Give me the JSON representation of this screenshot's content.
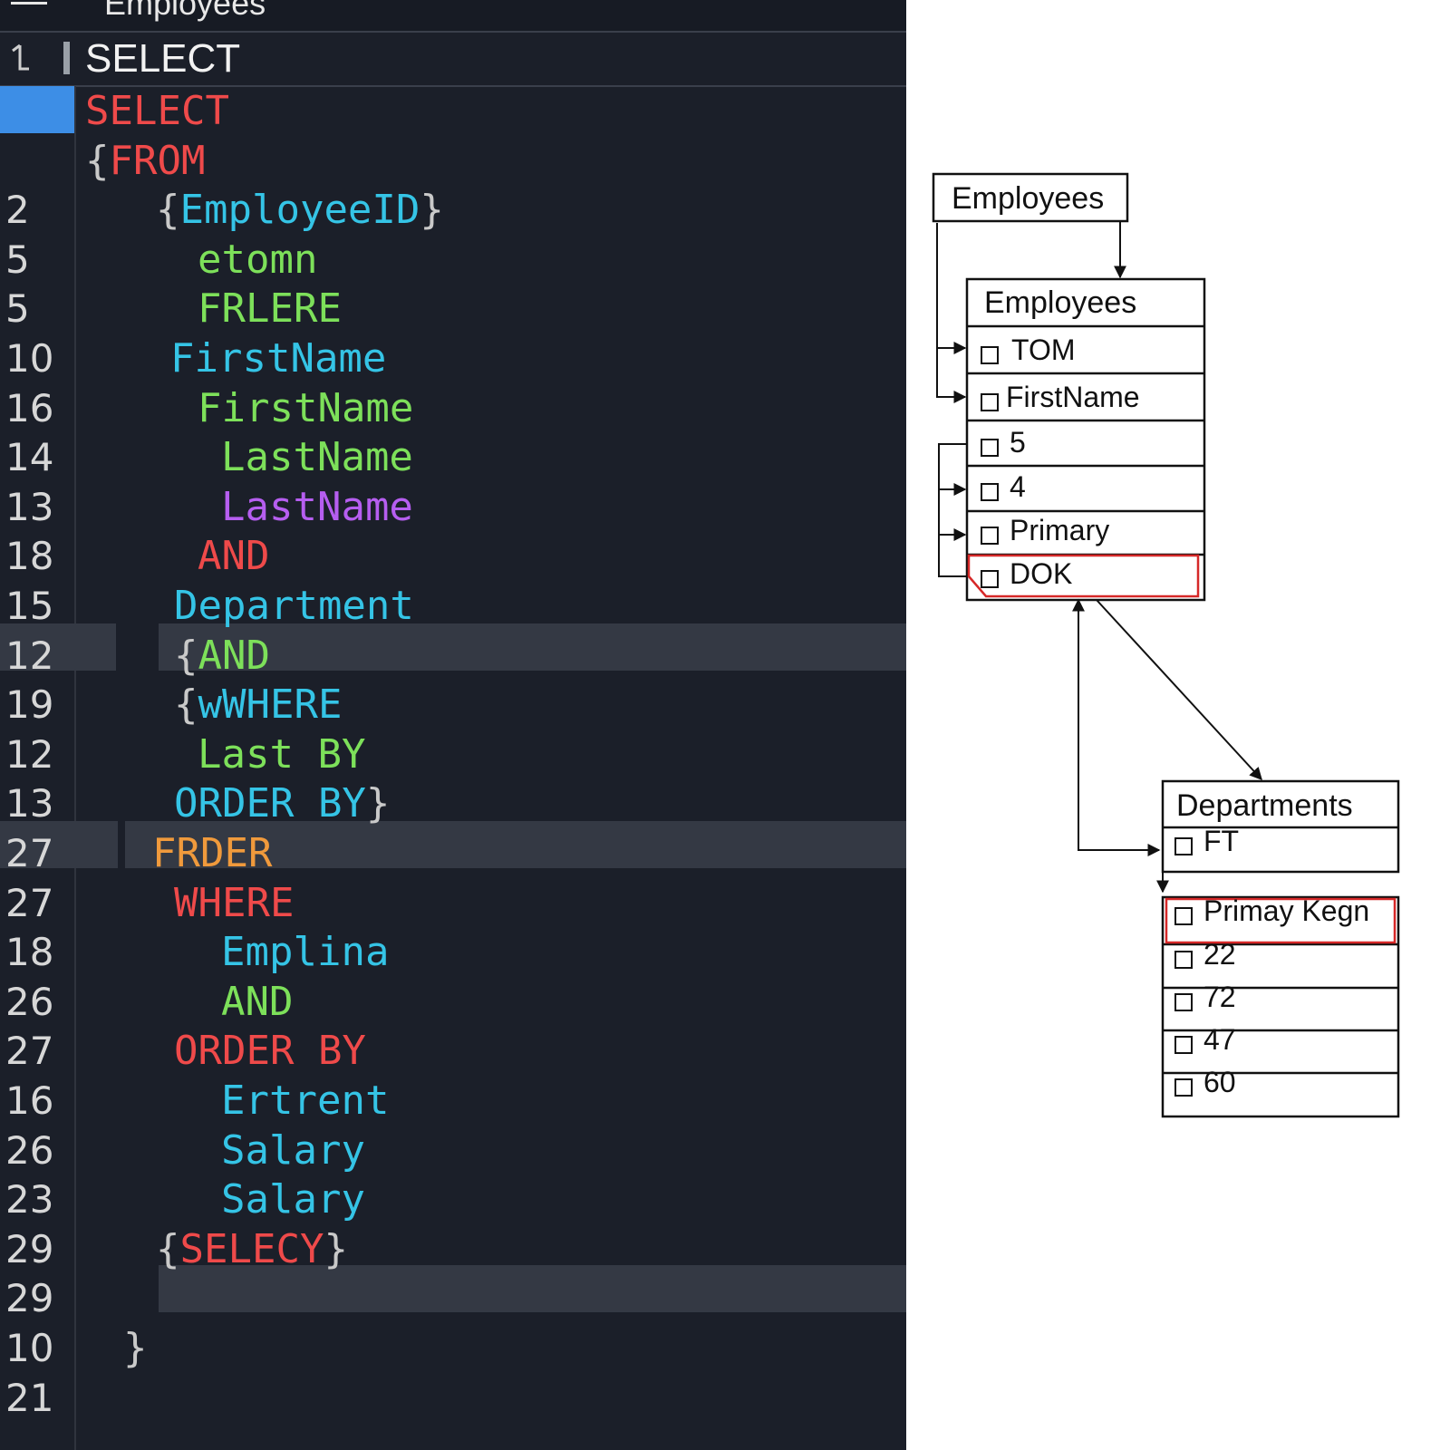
{
  "window": {
    "title": "Employees"
  },
  "editor": {
    "header_text": "SELECT",
    "lines": [
      {
        "num": "",
        "tokens": [
          {
            "t": "SELECT",
            "c": "red"
          }
        ]
      },
      {
        "num": "",
        "tokens": [
          {
            "t": "{",
            "c": "br"
          },
          {
            "t": "FROM",
            "c": "red"
          }
        ]
      },
      {
        "num": "2",
        "tokens": [
          {
            "t": "{",
            "c": "br"
          },
          {
            "t": "EmployeeID",
            "c": "cyan"
          },
          {
            "t": "}",
            "c": "br"
          }
        ]
      },
      {
        "num": "5",
        "tokens": [
          {
            "t": "etomn",
            "c": "green"
          }
        ]
      },
      {
        "num": "5",
        "tokens": [
          {
            "t": "FRLERE",
            "c": "green"
          }
        ]
      },
      {
        "num": "10",
        "tokens": [
          {
            "t": "FirstName",
            "c": "cyan"
          }
        ]
      },
      {
        "num": "16",
        "tokens": [
          {
            "t": "FirstName",
            "c": "green"
          }
        ]
      },
      {
        "num": "14",
        "tokens": [
          {
            "t": "LastName",
            "c": "green"
          }
        ]
      },
      {
        "num": "13",
        "tokens": [
          {
            "t": "LastName",
            "c": "purple"
          }
        ]
      },
      {
        "num": "18",
        "tokens": [
          {
            "t": "AND",
            "c": "red"
          }
        ]
      },
      {
        "num": "15",
        "tokens": [
          {
            "t": "Department",
            "c": "cyan"
          }
        ]
      },
      {
        "num": "12",
        "tokens": [
          {
            "t": "{",
            "c": "br"
          },
          {
            "t": "AND",
            "c": "green"
          }
        ]
      },
      {
        "num": "19",
        "tokens": [
          {
            "t": "{",
            "c": "br"
          },
          {
            "t": "wWHERE",
            "c": "cyan"
          }
        ]
      },
      {
        "num": "12",
        "tokens": [
          {
            "t": "Last BY",
            "c": "green"
          }
        ]
      },
      {
        "num": "13",
        "tokens": [
          {
            "t": "ORDER BY",
            "c": "cyan"
          },
          {
            "t": "}",
            "c": "br"
          }
        ]
      },
      {
        "num": "27",
        "tokens": [
          {
            "t": "FRDER",
            "c": "orange"
          }
        ]
      },
      {
        "num": "27",
        "tokens": [
          {
            "t": "WHERE",
            "c": "red"
          }
        ]
      },
      {
        "num": "18",
        "tokens": [
          {
            "t": "Emplina",
            "c": "cyan"
          }
        ]
      },
      {
        "num": "26",
        "tokens": [
          {
            "t": "AND",
            "c": "green"
          }
        ]
      },
      {
        "num": "27",
        "tokens": [
          {
            "t": "ORDER BY",
            "c": "red"
          }
        ]
      },
      {
        "num": "16",
        "tokens": [
          {
            "t": "Ertrent",
            "c": "cyan"
          }
        ]
      },
      {
        "num": "26",
        "tokens": [
          {
            "t": "Salary",
            "c": "cyan"
          }
        ]
      },
      {
        "num": "23",
        "tokens": [
          {
            "t": "Salary",
            "c": "cyan"
          }
        ]
      },
      {
        "num": "29",
        "tokens": [
          {
            "t": "{",
            "c": "br"
          },
          {
            "t": "SELECY",
            "c": "red"
          },
          {
            "t": "}",
            "c": "br"
          }
        ]
      },
      {
        "num": "29",
        "tokens": []
      },
      {
        "num": "10",
        "tokens": [
          {
            "t": "}",
            "c": "br"
          }
        ]
      },
      {
        "num": "21",
        "tokens": []
      }
    ]
  },
  "diagram": {
    "top_box": {
      "title": "Employees"
    },
    "employees_table": {
      "title": "Employees",
      "rows": [
        "TOM",
        "FirstName",
        "5",
        "4",
        "Primary",
        "DOK"
      ],
      "highlighted_row": "DOK"
    },
    "departments_table": {
      "title": "Departments",
      "rows": [
        "FT"
      ]
    },
    "values_table": {
      "rows": [
        "Primay Kegn",
        "22",
        "72",
        "47",
        "60"
      ],
      "highlighted_row": "Primay Kegn"
    }
  },
  "colors": {
    "editor_bg": "#1b1f29",
    "gutter_active": "#3d8ee6",
    "line_highlight": "#343944",
    "highlight_red": "#d62828"
  }
}
